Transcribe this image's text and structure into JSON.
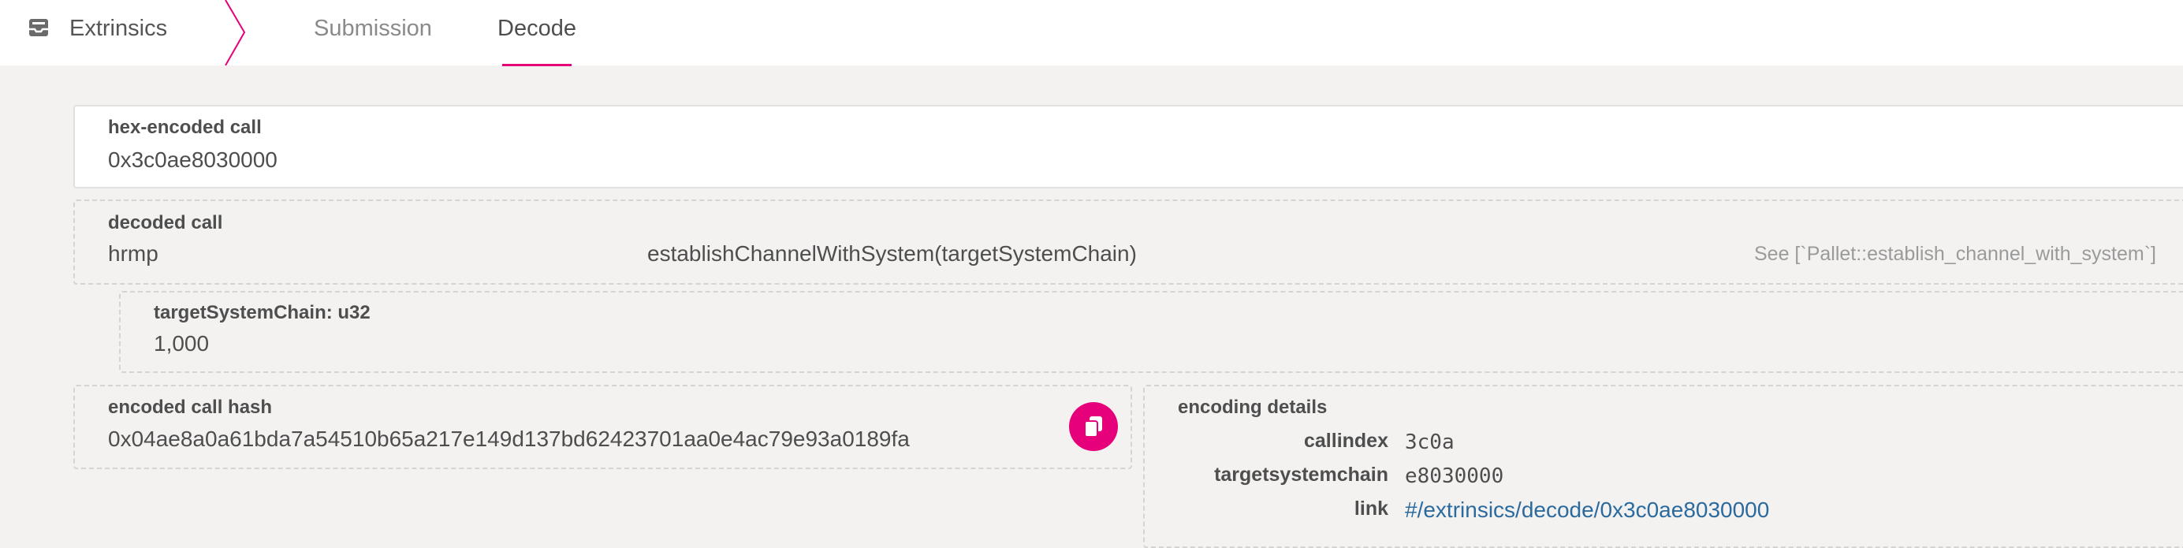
{
  "header": {
    "section_label": "Extrinsics",
    "section_icon": "inbox-icon",
    "tabs": [
      {
        "label": "Submission",
        "active": false
      },
      {
        "label": "Decode",
        "active": true
      }
    ],
    "accent_color": "#e6007a"
  },
  "hex_input": {
    "label": "hex-encoded call",
    "value": "0x3c0ae8030000"
  },
  "decoded_call": {
    "label": "decoded call",
    "pallet": "hrmp",
    "method": "establishChannelWithSystem(targetSystemChain)",
    "docs": "See [`Pallet::establish_channel_with_system`]"
  },
  "param": {
    "label": "targetSystemChain: u32",
    "value": "1,000"
  },
  "call_hash": {
    "label": "encoded call hash",
    "value": "0x04ae8a0a61bda7a54510b65a217e149d137bd62423701aa0e4ac79e93a0189fa",
    "copy_icon": "copy-icon"
  },
  "encoding_details": {
    "label": "encoding details",
    "rows": [
      {
        "key": "callindex",
        "value": "3c0a"
      },
      {
        "key": "targetsystemchain",
        "value": "e8030000"
      },
      {
        "key": "link",
        "value": "#/extrinsics/decode/0x3c0ae8030000"
      }
    ],
    "link_color": "#2b6a9e"
  }
}
